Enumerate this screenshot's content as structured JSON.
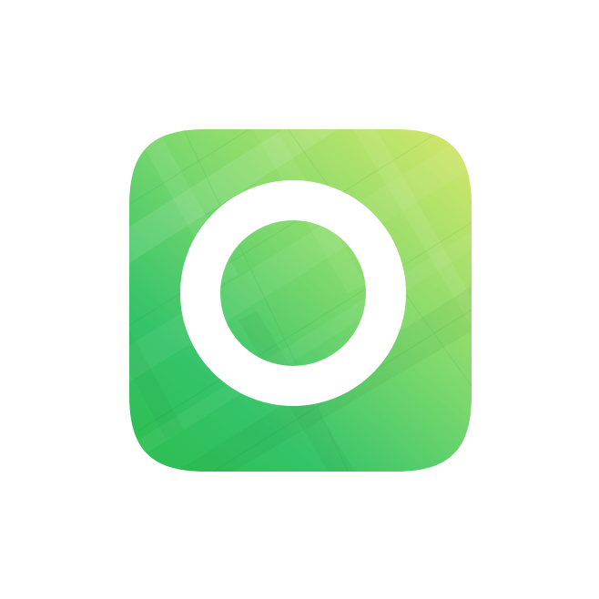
{
  "app_icon": {
    "icon": "camera-ring-icon",
    "colors": {
      "gradient_top_right": "#d8e86a",
      "gradient_mid": "#7fd96d",
      "gradient_bottom_left": "#35c36a",
      "gradient_bottom": "#2fbf55",
      "ring": "#ffffff",
      "facet_light": "#ffffff",
      "facet_dark": "#0a6a2a"
    }
  }
}
